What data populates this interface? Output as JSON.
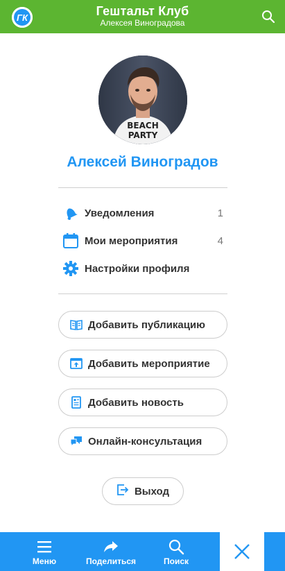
{
  "header": {
    "logo_text": "ГК",
    "title": "Гештальт Клуб",
    "subtitle": "Алексея Виноградова"
  },
  "profile": {
    "name": "Алексей Виноградов",
    "avatar_shirt_text_line1": "BEACH",
    "avatar_shirt_text_line2": "PARTY"
  },
  "menu": {
    "notifications": {
      "label": "Уведомления",
      "count": "1"
    },
    "events": {
      "label": "Мои мероприятия",
      "count": "4"
    },
    "settings": {
      "label": "Настройки профиля"
    }
  },
  "actions": {
    "add_publication": "Добавить публикацию",
    "add_event": "Добавить мероприятие",
    "add_news": "Добавить новость",
    "consultation": "Онлайн-консультация"
  },
  "logout": "Выход",
  "bottom_nav": {
    "menu": "Меню",
    "share": "Поделиться",
    "search": "Поиск"
  },
  "colors": {
    "header_green": "#5cb531",
    "accent_blue": "#2196f3"
  }
}
